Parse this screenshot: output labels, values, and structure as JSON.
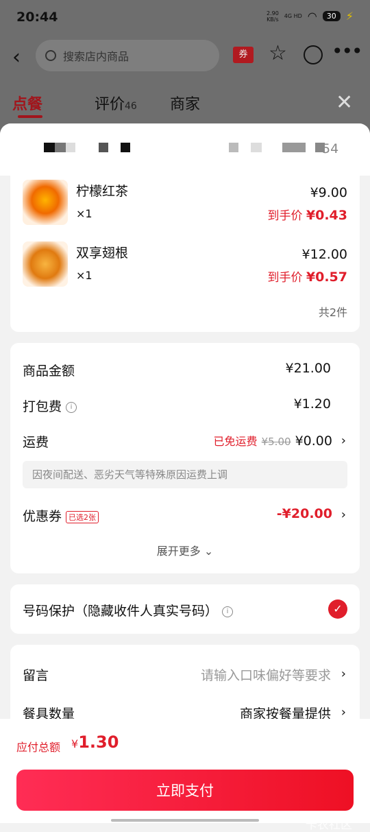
{
  "status": {
    "time": "20:44",
    "net_speed": "2.90",
    "net_unit": "KB/s",
    "net_type": "4G HD",
    "battery": "30"
  },
  "topbar": {
    "search_placeholder": "搜索店内商品",
    "coupon_label": "券"
  },
  "tabs": [
    {
      "label": "点餐",
      "sub": ""
    },
    {
      "label": "评价",
      "sub": "46"
    },
    {
      "label": "商家",
      "sub": ""
    }
  ],
  "sheet_head": {
    "right_text": "54"
  },
  "items": [
    {
      "name": "柠檬红茶",
      "qty": "×1",
      "price": "¥9.00",
      "final_label": "到手价",
      "final_price": "¥0.43"
    },
    {
      "name": "双享翅根",
      "qty": "×1",
      "price": "¥12.00",
      "final_label": "到手价",
      "final_price": "¥0.57"
    }
  ],
  "items_count": "共2件",
  "fees": {
    "goods_label": "商品金额",
    "goods_value": "¥21.00",
    "pack_label": "打包费",
    "pack_value": "¥1.20",
    "ship_label": "运费",
    "ship_free": "已免运费",
    "ship_original": "¥5.00",
    "ship_value": "¥0.00",
    "ship_notice": "因夜间配送、恶劣天气等特殊原因运费上调",
    "coupon_label": "优惠券",
    "coupon_badge": "已选2张",
    "coupon_value": "-¥20.00",
    "expand_label": "展开更多"
  },
  "privacy_label": "号码保护（隐藏收件人真实号码）",
  "remarks": {
    "note_label": "留言",
    "note_placeholder": "请输入口味偏好等要求",
    "utensil_label": "餐具数量",
    "utensil_value": "商家按餐量提供"
  },
  "footer": {
    "total_label": "应付总额",
    "total_currency": "¥",
    "total_value": "1.30",
    "pay_label": "立即支付",
    "watermark": "卡农社区"
  },
  "colors": {
    "accent": "#e01e2b",
    "tab_active": "#a1151c"
  }
}
